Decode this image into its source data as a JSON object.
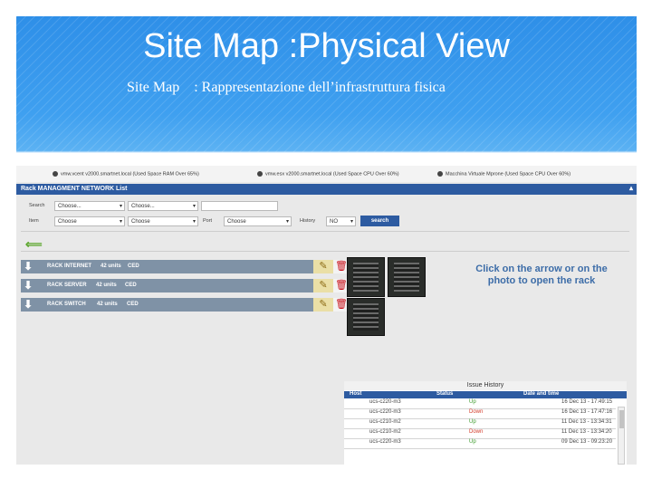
{
  "slide": {
    "title": "Site Map :Physical View",
    "subtitle_a": "Site Map",
    "subtitle_b": ": Rappresentazione dell’infrastruttura fisica"
  },
  "alerts": [
    {
      "text": "vmw.vcent v2000.smartnet.local   (Used Space RAM Over 65%)"
    },
    {
      "text": "vmw.esx v2000.smartnet.local   (Used Space CPU Over 60%)"
    },
    {
      "text": "Macchina Virtuale Mprone   (Used Space CPU Over 60%)"
    }
  ],
  "panel": {
    "title": "Rack MANAGMENT NETWORK List",
    "collapse_icon": "caret-up-icon"
  },
  "filters": {
    "search_label": "Search",
    "search_select1": "Choose...",
    "search_select2": "Choose...",
    "item_label": "Item",
    "item_select1": "Choose",
    "item_select2": "Choose",
    "port_label": "Port",
    "port_select": "Choose",
    "history_label": "History",
    "history_select": "NO",
    "search_button": "search"
  },
  "racks": [
    {
      "name": "RACK INTERNET",
      "units": "42 units",
      "code": "CED"
    },
    {
      "name": "RACK SERVER",
      "units": "42 units",
      "code": "CED"
    },
    {
      "name": "RACK SWITCH",
      "units": "42 units",
      "code": "CED"
    }
  ],
  "hint_line1": "Click on the arrow or on the",
  "hint_line2": "photo to open the rack",
  "history": {
    "title": "Issue History",
    "columns": [
      "Host",
      "Status",
      "Date and time"
    ],
    "rows": [
      {
        "host": "ucs-c220-m3",
        "status": "Up",
        "date": "16 Dec 13 - 17:49:15"
      },
      {
        "host": "ucs-c220-m3",
        "status": "Down",
        "date": "16 Dec 13 - 17:47:16"
      },
      {
        "host": "ucs-c210-m2",
        "status": "Up",
        "date": "11 Dec 13 - 13:34:31"
      },
      {
        "host": "ucs-c210-m2",
        "status": "Down",
        "date": "11 Dec 13 - 13:34:20"
      },
      {
        "host": "ucs-c220-m3",
        "status": "Up",
        "date": "09 Dec 13 - 09:23:20"
      }
    ]
  },
  "colors": {
    "up": "#3a9a2a",
    "down": "#d33a2a",
    "accent": "#2d5ba1"
  }
}
